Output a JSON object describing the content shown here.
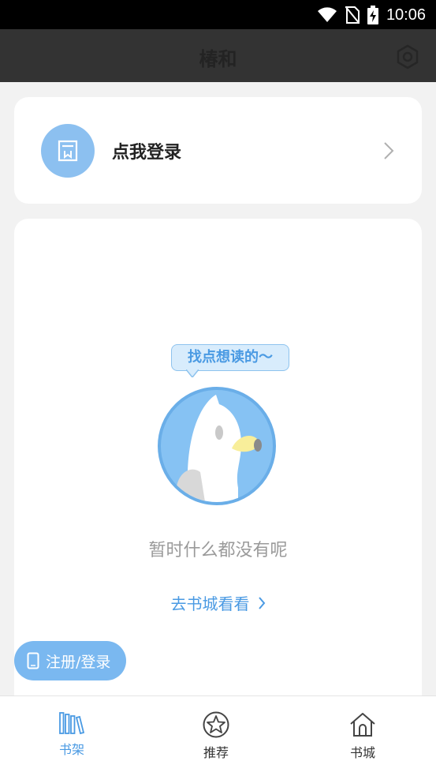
{
  "status_bar": {
    "time": "10:06",
    "icons": [
      "wifi-icon",
      "no-sim-icon",
      "battery-charging-icon"
    ]
  },
  "app_bar": {
    "title": "椿和",
    "settings_icon": "settings-icon"
  },
  "login_card": {
    "label": "点我登录",
    "avatar_icon": "book-icon",
    "chevron_icon": "chevron-right-icon"
  },
  "shelf": {
    "bubble_text": "找点想读的～",
    "mascot": "bird-mascot",
    "empty_text": "暂时什么都没有呢",
    "goto_link": "去书城看看",
    "link_chevron": "chevron-right-icon"
  },
  "register_button": {
    "label": "注册/登录",
    "icon": "phone-icon"
  },
  "tabs": [
    {
      "label": "书架",
      "icon": "bookshelf-icon",
      "active": true
    },
    {
      "label": "推荐",
      "icon": "star-badge-icon",
      "active": false
    },
    {
      "label": "书城",
      "icon": "house-icon",
      "active": false
    }
  ],
  "colors": {
    "accent": "#4a9ae3",
    "app_bar": "#333333",
    "background": "#f2f2f2",
    "button": "#7ab8f0"
  }
}
